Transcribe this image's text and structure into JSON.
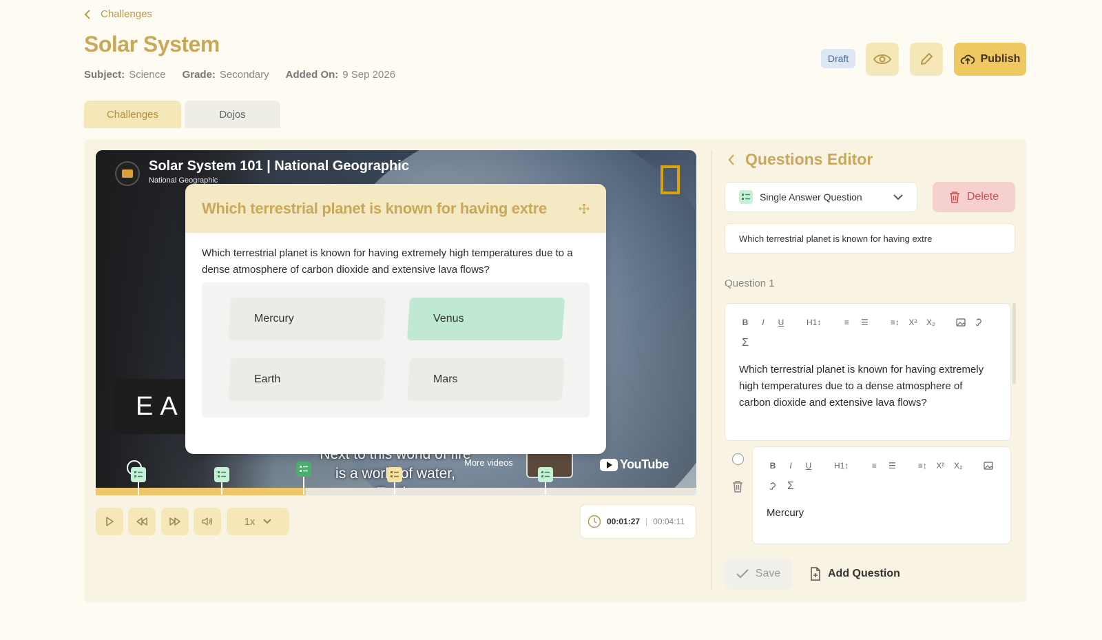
{
  "header": {
    "back_label": "Challenges",
    "title": "Solar System",
    "meta": [
      {
        "label": "Subject:",
        "value": "Science"
      },
      {
        "label": "Grade:",
        "value": "Secondary"
      },
      {
        "label": "Added On:",
        "value": "9 Sep 2026"
      }
    ],
    "status_badge": "Draft",
    "publish_label": "Publish"
  },
  "tabs": [
    {
      "label": "Challenges",
      "active": true
    },
    {
      "label": "Dojos",
      "active": false
    }
  ],
  "video": {
    "title": "Solar System 101 | National Geographic",
    "channel": "National Geographic",
    "overlay_text": "EAR",
    "caption_line1": "Next to this world of fire",
    "caption_line2": "is a world of water, Earth.",
    "more_videos": "More videos",
    "provider": "YouTube",
    "progress_fraction": 0.35
  },
  "quiz": {
    "title": "Which terrestrial planet is known for having extre",
    "question": "Which terrestrial planet is known for having extremely high temperatures due to a dense atmosphere of carbon dioxide and extensive lava flows?",
    "answers": [
      {
        "label": "Mercury",
        "correct": false
      },
      {
        "label": "Venus",
        "correct": true
      },
      {
        "label": "Earth",
        "correct": false
      },
      {
        "label": "Mars",
        "correct": false
      }
    ]
  },
  "controls": {
    "speed": "1x",
    "time_current": "00:01:27",
    "time_total": "00:04:11"
  },
  "editor": {
    "title": "Questions Editor",
    "question_type": "Single Answer Question",
    "delete_label": "Delete",
    "title_value": "Which terrestrial planet is known for having extre",
    "question_label": "Question 1",
    "question_text": "Which terrestrial planet is known for having extremely high temperatures due to a dense atmosphere of carbon dioxide and extensive lava flows?",
    "answer_text": "Mercury",
    "toolbar": {
      "bold": "B",
      "italic": "I",
      "underline": "U",
      "heading": "H1↕",
      "ordered": "≡",
      "bullet": "☰",
      "align": "≡↕",
      "sup": "X²",
      "sub": "X₂",
      "formula": "Σ"
    },
    "save_label": "Save",
    "add_question_label": "Add Question"
  },
  "colors": {
    "accent": "#c9a85a",
    "accent_light": "#f5e7b8",
    "publish": "#efc862",
    "correct": "#bfe9d3",
    "danger": "#d24d4d",
    "marker_green": "#4cae6e"
  }
}
